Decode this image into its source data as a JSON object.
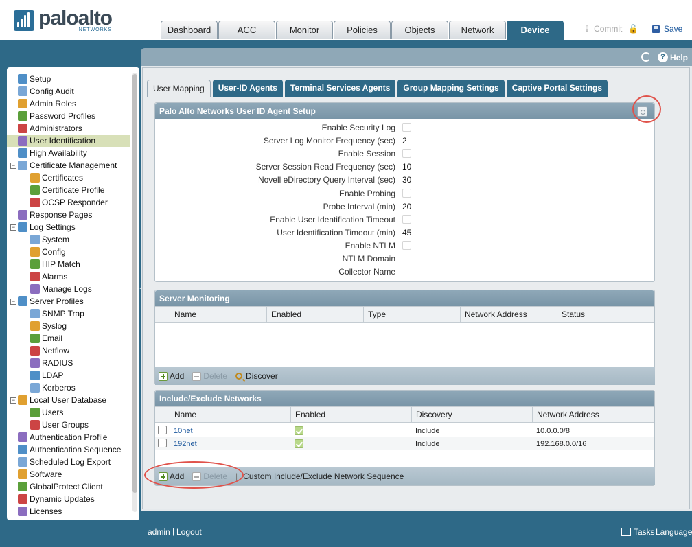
{
  "brand": {
    "name": "paloalto",
    "sub": "NETWORKS"
  },
  "main_tabs": [
    "Dashboard",
    "ACC",
    "Monitor",
    "Policies",
    "Objects",
    "Network",
    "Device"
  ],
  "active_tab": "Device",
  "actions": {
    "commit": "Commit",
    "save": "Save",
    "help": "Help"
  },
  "sidebar": {
    "items": [
      {
        "label": "Setup",
        "icon": "setup-icon"
      },
      {
        "label": "Config Audit",
        "icon": "config-audit-icon"
      },
      {
        "label": "Admin Roles",
        "icon": "admin-roles-icon"
      },
      {
        "label": "Password Profiles",
        "icon": "password-profiles-icon"
      },
      {
        "label": "Administrators",
        "icon": "administrators-icon"
      },
      {
        "label": "User Identification",
        "icon": "user-identification-icon",
        "selected": true
      },
      {
        "label": "High Availability",
        "icon": "high-availability-icon"
      },
      {
        "label": "Certificate Management",
        "icon": "certificate-management-icon",
        "expander": "−"
      },
      {
        "label": "Certificates",
        "icon": "certificates-icon",
        "indent": 1
      },
      {
        "label": "Certificate Profile",
        "icon": "certificate-profile-icon",
        "indent": 1
      },
      {
        "label": "OCSP Responder",
        "icon": "ocsp-responder-icon",
        "indent": 1
      },
      {
        "label": "Response Pages",
        "icon": "response-pages-icon"
      },
      {
        "label": "Log Settings",
        "icon": "log-settings-icon",
        "expander": "−"
      },
      {
        "label": "System",
        "icon": "system-icon",
        "indent": 1
      },
      {
        "label": "Config",
        "icon": "config-icon",
        "indent": 1
      },
      {
        "label": "HIP Match",
        "icon": "hip-match-icon",
        "indent": 1
      },
      {
        "label": "Alarms",
        "icon": "alarms-icon",
        "indent": 1
      },
      {
        "label": "Manage Logs",
        "icon": "manage-logs-icon",
        "indent": 1
      },
      {
        "label": "Server Profiles",
        "icon": "server-profiles-icon",
        "expander": "−"
      },
      {
        "label": "SNMP Trap",
        "icon": "snmp-trap-icon",
        "indent": 1
      },
      {
        "label": "Syslog",
        "icon": "syslog-icon",
        "indent": 1
      },
      {
        "label": "Email",
        "icon": "email-icon",
        "indent": 1
      },
      {
        "label": "Netflow",
        "icon": "netflow-icon",
        "indent": 1
      },
      {
        "label": "RADIUS",
        "icon": "radius-icon",
        "indent": 1
      },
      {
        "label": "LDAP",
        "icon": "ldap-icon",
        "indent": 1
      },
      {
        "label": "Kerberos",
        "icon": "kerberos-icon",
        "indent": 1
      },
      {
        "label": "Local User Database",
        "icon": "local-user-database-icon",
        "expander": "−"
      },
      {
        "label": "Users",
        "icon": "users-icon",
        "indent": 1
      },
      {
        "label": "User Groups",
        "icon": "user-groups-icon",
        "indent": 1
      },
      {
        "label": "Authentication Profile",
        "icon": "authentication-profile-icon"
      },
      {
        "label": "Authentication Sequence",
        "icon": "authentication-sequence-icon"
      },
      {
        "label": "Scheduled Log Export",
        "icon": "scheduled-log-export-icon"
      },
      {
        "label": "Software",
        "icon": "software-icon"
      },
      {
        "label": "GlobalProtect Client",
        "icon": "globalprotect-client-icon"
      },
      {
        "label": "Dynamic Updates",
        "icon": "dynamic-updates-icon"
      },
      {
        "label": "Licenses",
        "icon": "licenses-icon"
      }
    ]
  },
  "subtabs": [
    "User Mapping",
    "User-ID Agents",
    "Terminal Services Agents",
    "Group Mapping Settings",
    "Captive Portal Settings"
  ],
  "active_subtab": "User Mapping",
  "agent_setup": {
    "title": "Palo Alto Networks User ID Agent Setup",
    "fields": [
      {
        "label": "Enable Security Log",
        "type": "checkbox",
        "checked": false
      },
      {
        "label": "Server Log Monitor Frequency (sec)",
        "type": "value",
        "value": "2"
      },
      {
        "label": "Enable Session",
        "type": "checkbox",
        "checked": false
      },
      {
        "label": "Server Session Read Frequency (sec)",
        "type": "value",
        "value": "10"
      },
      {
        "label": "Novell eDirectory Query Interval (sec)",
        "type": "value",
        "value": "30"
      },
      {
        "label": "Enable Probing",
        "type": "checkbox",
        "checked": false
      },
      {
        "label": "Probe Interval (min)",
        "type": "value",
        "value": "20"
      },
      {
        "label": "Enable User Identification Timeout",
        "type": "checkbox",
        "checked": false
      },
      {
        "label": "User Identification Timeout (min)",
        "type": "value",
        "value": "45"
      },
      {
        "label": "Enable NTLM",
        "type": "checkbox",
        "checked": false
      },
      {
        "label": "NTLM Domain",
        "type": "value",
        "value": ""
      },
      {
        "label": "Collector Name",
        "type": "value",
        "value": ""
      }
    ]
  },
  "server_monitoring": {
    "title": "Server Monitoring",
    "columns": [
      "Name",
      "Enabled",
      "Type",
      "Network Address",
      "Status"
    ],
    "rows": [],
    "toolbar": {
      "add": "Add",
      "delete": "Delete",
      "discover": "Discover"
    }
  },
  "include_exclude": {
    "title": "Include/Exclude Networks",
    "columns": [
      "Name",
      "Enabled",
      "Discovery",
      "Network Address"
    ],
    "rows": [
      {
        "name": "10net",
        "enabled": true,
        "discovery": "Include",
        "address": "10.0.0.0/8"
      },
      {
        "name": "192net",
        "enabled": true,
        "discovery": "Include",
        "address": "192.168.0.0/16"
      }
    ],
    "toolbar": {
      "add": "Add",
      "delete": "Delete",
      "sequence": "Custom Include/Exclude Network Sequence"
    }
  },
  "footer": {
    "user": "admin",
    "logout": "Logout",
    "tasks": "Tasks",
    "language": "Language"
  }
}
